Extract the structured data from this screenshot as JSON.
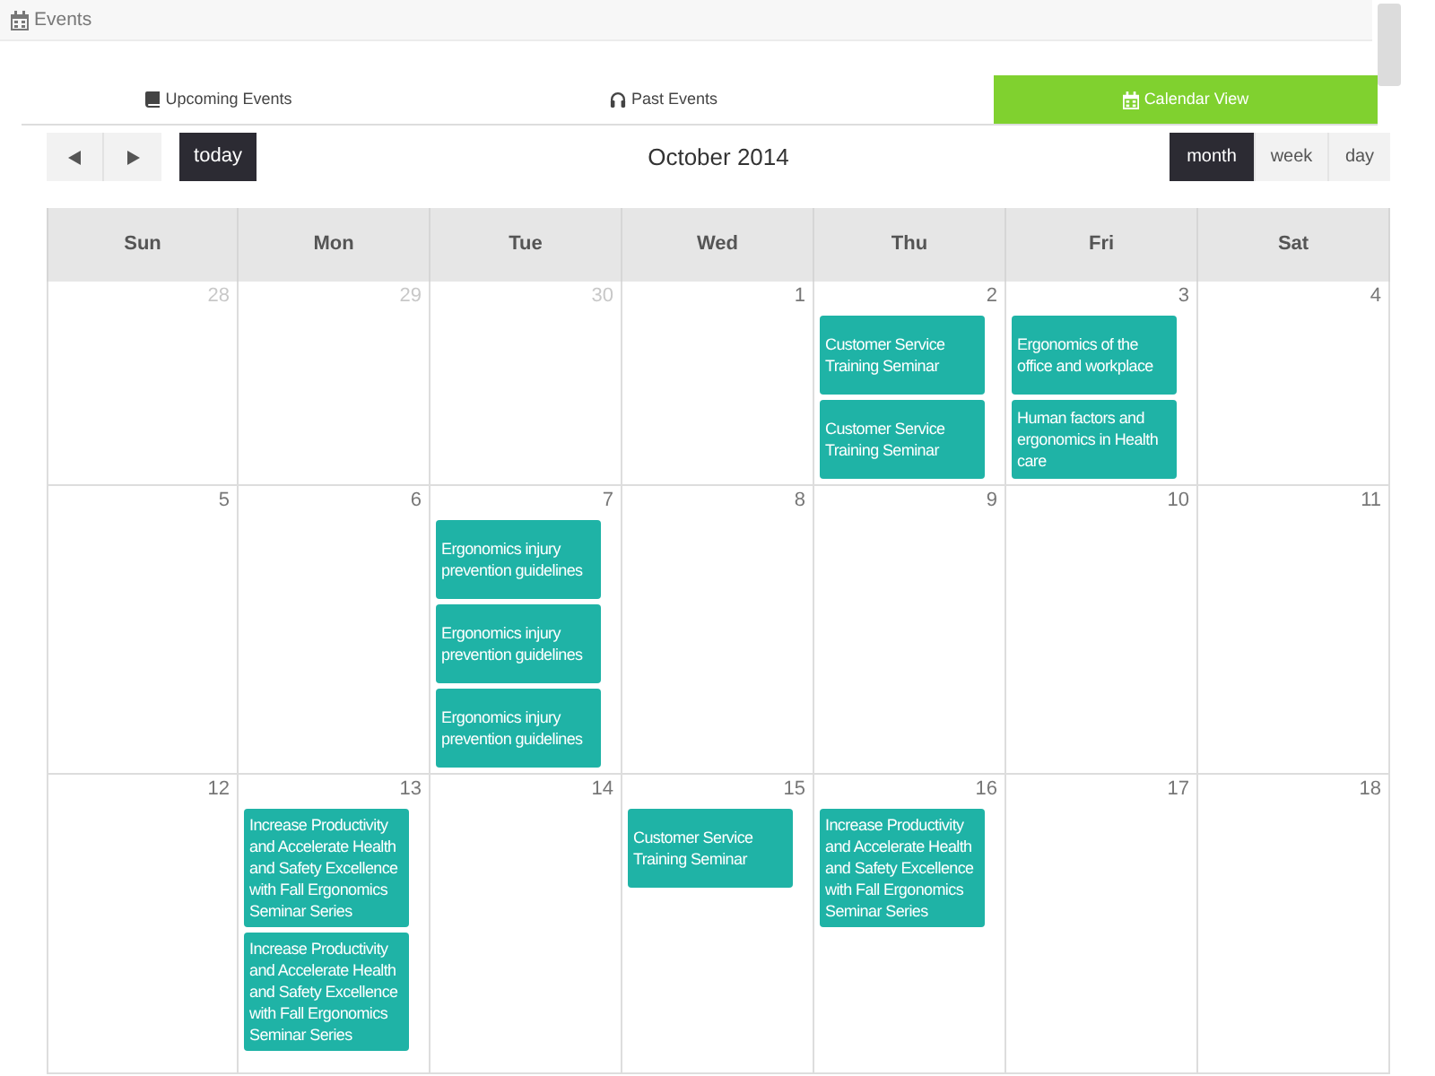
{
  "page_header": {
    "title": "Events"
  },
  "tabs": [
    {
      "label": "Upcoming Events",
      "selected": false
    },
    {
      "label": "Past Events",
      "selected": false
    },
    {
      "label": "Calendar View",
      "selected": true
    }
  ],
  "toolbar": {
    "today_button": "today",
    "title": "October 2014",
    "views": [
      {
        "label": "month",
        "selected": true
      },
      {
        "label": "week",
        "selected": false
      },
      {
        "label": "day",
        "selected": false
      }
    ]
  },
  "calendar": {
    "weekdays": [
      "Sun",
      "Mon",
      "Tue",
      "Wed",
      "Thu",
      "Fri",
      "Sat"
    ],
    "weeks": [
      [
        {
          "day": "28",
          "other_month": true
        },
        {
          "day": "29",
          "other_month": true
        },
        {
          "day": "30",
          "other_month": true
        },
        {
          "day": "1",
          "other_month": false
        },
        {
          "day": "2",
          "other_month": false,
          "events": [
            "Customer Service Training Seminar",
            "Customer Service Training Seminar"
          ]
        },
        {
          "day": "3",
          "other_month": false,
          "events": [
            "Ergonomics of the office and workplace",
            "Human factors and ergonomics in Health care"
          ]
        },
        {
          "day": "4",
          "other_month": false
        }
      ],
      [
        {
          "day": "5",
          "other_month": false
        },
        {
          "day": "6",
          "other_month": false
        },
        {
          "day": "7",
          "other_month": false,
          "events": [
            "Ergonomics injury prevention guidelines",
            "Ergonomics injury prevention guidelines",
            "Ergonomics injury prevention guidelines"
          ]
        },
        {
          "day": "8",
          "other_month": false
        },
        {
          "day": "9",
          "other_month": false
        },
        {
          "day": "10",
          "other_month": false
        },
        {
          "day": "11",
          "other_month": false
        }
      ],
      [
        {
          "day": "12",
          "other_month": false
        },
        {
          "day": "13",
          "other_month": false,
          "events": [
            "Increase Productivity and Accelerate Health and Safety Excellence with Fall Ergonomics Seminar Series",
            "Increase Productivity and Accelerate Health and Safety Excellence with Fall Ergonomics Seminar Series"
          ]
        },
        {
          "day": "14",
          "other_month": false
        },
        {
          "day": "15",
          "other_month": false,
          "events": [
            "Customer Service Training Seminar"
          ]
        },
        {
          "day": "16",
          "other_month": false,
          "events": [
            "Increase Productivity and Accelerate Health and Safety Excellence with Fall Ergonomics Seminar Series"
          ]
        },
        {
          "day": "17",
          "other_month": false
        },
        {
          "day": "18",
          "other_month": false
        }
      ]
    ]
  }
}
